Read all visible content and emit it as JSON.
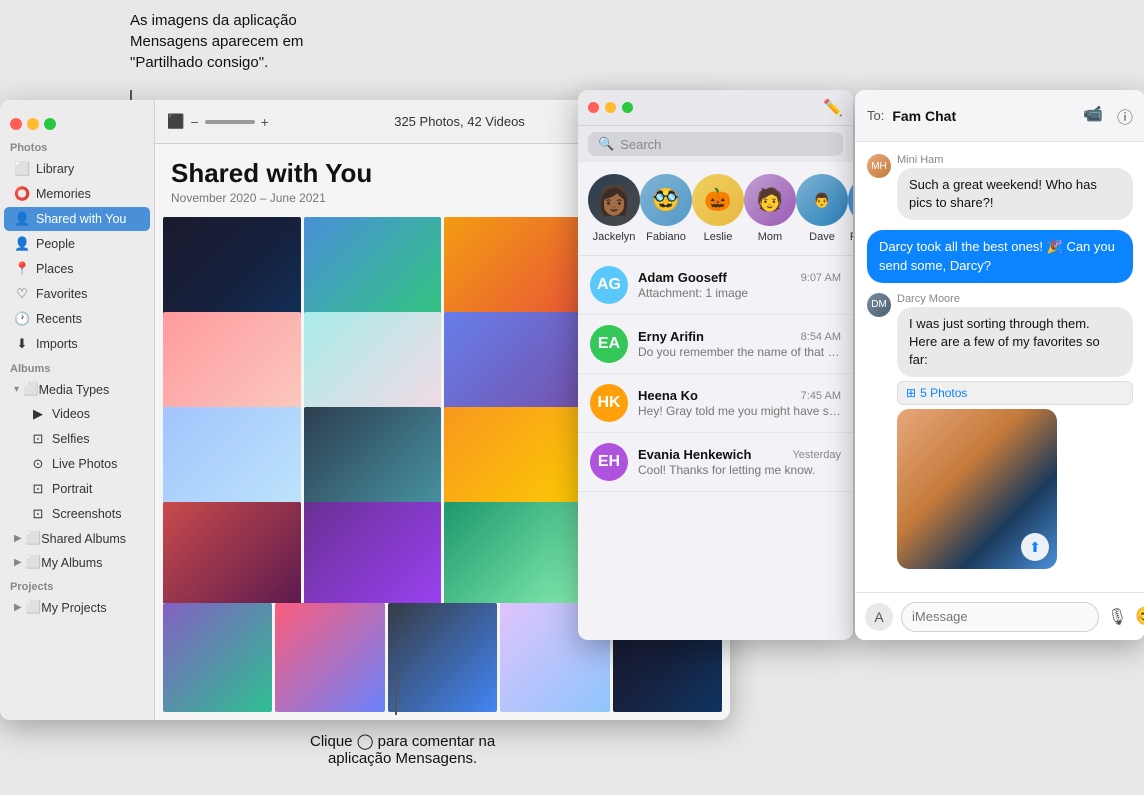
{
  "annotations": {
    "top": "As imagens da aplicação\nMensagens aparecem em\n\"Partilhado consigo\".",
    "bottom": "Clique ◯ para comentar na\naplicação Mensagens."
  },
  "photos_window": {
    "traffic_lights": {
      "red": "close",
      "yellow": "minimize",
      "green": "maximize"
    },
    "toolbar": {
      "photo_count": "325 Photos, 42 Videos"
    },
    "title": "Shared with You",
    "subtitle": "November 2020 – June 2021",
    "sidebar": {
      "sections": [
        {
          "header": "Photos",
          "items": [
            {
              "label": "Library",
              "icon": "📷",
              "active": false
            },
            {
              "label": "Memories",
              "icon": "⭕",
              "active": false
            },
            {
              "label": "Shared with You",
              "icon": "👤",
              "active": true
            },
            {
              "label": "People",
              "icon": "👤",
              "active": false
            },
            {
              "label": "Places",
              "icon": "📍",
              "active": false
            },
            {
              "label": "Favorites",
              "icon": "♡",
              "active": false
            },
            {
              "label": "Recents",
              "icon": "🕐",
              "active": false
            },
            {
              "label": "Imports",
              "icon": "⬇",
              "active": false
            }
          ]
        },
        {
          "header": "Albums",
          "groups": [
            {
              "label": "Media Types",
              "expanded": true,
              "items": [
                {
                  "label": "Videos"
                },
                {
                  "label": "Selfies"
                },
                {
                  "label": "Live Photos"
                },
                {
                  "label": "Portrait"
                },
                {
                  "label": "Screenshots"
                }
              ]
            },
            {
              "label": "Shared Albums",
              "expanded": false
            },
            {
              "label": "My Albums",
              "expanded": false
            }
          ]
        },
        {
          "header": "Projects",
          "groups": [
            {
              "label": "My Projects",
              "expanded": false
            }
          ]
        }
      ]
    }
  },
  "messages_window": {
    "search_placeholder": "Search",
    "pinned": [
      {
        "name": "Jackelyn",
        "emoji": "👩"
      },
      {
        "name": "Fabiano",
        "emoji": "🥸"
      },
      {
        "name": "Leslie",
        "emoji": "🎃"
      },
      {
        "name": "Mom",
        "emoji": "🧑"
      },
      {
        "name": "Dave",
        "emoji": "👨"
      },
      {
        "name": "Fam Chat",
        "emoji": "👨‍👩‍👧",
        "highlighted": true
      }
    ],
    "conversations": [
      {
        "name": "Adam Gooseff",
        "time": "9:07 AM",
        "preview": "Attachment: 1 image",
        "color": "#5ac8fa"
      },
      {
        "name": "Erny Arifin",
        "time": "8:54 AM",
        "preview": "Do you remember the name of that guy from brunch?",
        "color": "#34c759"
      },
      {
        "name": "Heena Ko",
        "time": "7:45 AM",
        "preview": "Hey! Gray told me you might have some good recommendations for our...",
        "color": "#ff9f0a"
      },
      {
        "name": "Evania Henkewich",
        "time": "Yesterday",
        "preview": "Cool! Thanks for letting me know.",
        "color": "#af52de"
      }
    ]
  },
  "chat_window": {
    "to_label": "To:",
    "title": "Fam Chat",
    "messages": [
      {
        "sender": "Mini Ham",
        "text": "Such a great weekend! Who has pics to share?!",
        "side": "left"
      },
      {
        "sender": "",
        "text": "Darcy took all the best ones! 🎉 Can you send some, Darcy?",
        "side": "right"
      },
      {
        "sender": "Darcy Moore",
        "text": "I was just sorting through them. Here are a few of my favorites so far:",
        "side": "left"
      },
      {
        "sender": "",
        "badge": "🔲 5 Photos",
        "photo": true,
        "side": "left"
      }
    ],
    "input_placeholder": "iMessage"
  }
}
